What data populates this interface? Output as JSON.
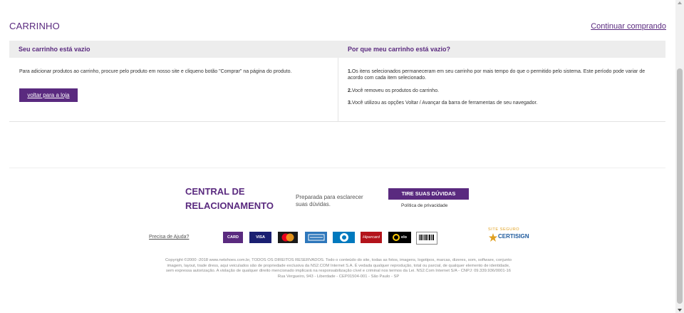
{
  "page": {
    "title": "CARRINHO",
    "continue_link": "Continuar comprando"
  },
  "cart": {
    "left_header": "Seu carrinho está vazio",
    "right_header": "Por que meu carrinho está vazio?",
    "left_text": "Para adicionar produtos ao carrinho, procure pelo produto em nosso site e cliqueno botão \"Comprar\" na página do produto.",
    "back_button": "voltar para a loja",
    "reasons": [
      {
        "num": "1.",
        "text": "Os itens selecionados permaneceram em seu carrinho por mais tempo do que o permitido pelo sistema. Este período pode variar de acordo com cada item selecionado."
      },
      {
        "num": "2.",
        "text": "Você removeu os produtos do carrinho."
      },
      {
        "num": "3.",
        "text": "Você utilizou as opções Voltar / Avançar da barra de ferramentas de seu navegador."
      }
    ]
  },
  "footer": {
    "central_line1": "CENTRAL DE",
    "central_line2": "RELACIONAMENTO",
    "prep_line1": "Preparada para esclarecer",
    "prep_line2": "suas dúvidas.",
    "doubts_button": "TIRE SUAS DÚVIDAS",
    "privacy": "Política de privacidade",
    "help": "Precisa de Ajuda?",
    "payments": [
      {
        "name": "pix-like-card",
        "label": "CARD",
        "color": "#5a2a7f"
      },
      {
        "name": "visa",
        "label": "VISA",
        "color": "#1a1f71"
      },
      {
        "name": "mastercard",
        "label": "MC",
        "color": "#eb001b"
      },
      {
        "name": "amex",
        "label": "AMEX",
        "color": "#2e77bb"
      },
      {
        "name": "diners",
        "label": "DC",
        "color": "#0079be"
      },
      {
        "name": "hipercard",
        "label": "Hipercard",
        "color": "#b3131b"
      },
      {
        "name": "elo",
        "label": "elo",
        "color": "#000000"
      },
      {
        "name": "boleto",
        "label": "BOLETO",
        "color": "#ffffff"
      }
    ],
    "site_seguro_label": "SITE SEGURO",
    "certisign": "CERTISIGN",
    "copyright_lines": [
      "Copyright ©2000 -2018 www.netshoes.com.br, TODOS OS DIREITOS RESERVADOS. Todo o conteúdo do site, todas as fotos, imagens, logotipos, marcas, dizeres, som, software, conjunto",
      "imagem, layout, trade dress, aqui veiculados são de propriedade exclusiva da NS2.COM Internet S.A. É vedada qualquer reprodução, total ou parcial, de qualquer elemento de identidade,",
      "sem expressa autorização. A violação de qualquer direito mencionado implicará na responsabilização cível e criminal nos termos da Lei. NS2.Com Internet S/A - CNPJ: 09.339.936/0001-16",
      "Rua Vergueiro, 943 - Liberdade - CEP01504-001 - São Paulo - SP"
    ]
  }
}
